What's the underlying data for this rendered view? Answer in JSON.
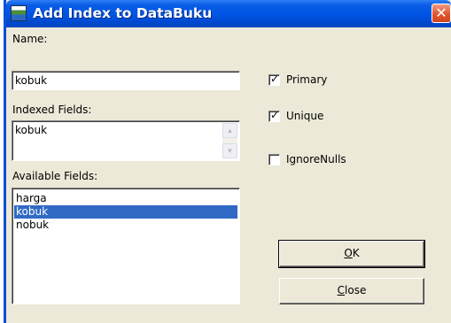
{
  "window": {
    "title": "Add Index to DataBuku",
    "close_glyph": "✕",
    "icon": "app-icon"
  },
  "form": {
    "name_label": "Name:",
    "name_value": "kobuk",
    "indexed_label": "Indexed Fields:",
    "indexed_value": "kobuk",
    "available_label": "Available Fields:",
    "available_items": [
      "harga",
      "kobuk",
      "nobuk"
    ],
    "selected_item": "kobuk"
  },
  "options": {
    "primary": {
      "label": "Primary",
      "checked": true
    },
    "unique": {
      "label": "Unique",
      "checked": true
    },
    "ignore_nulls": {
      "label": "IgnoreNulls",
      "checked": false
    }
  },
  "buttons": {
    "ok": {
      "mnemonic": "O",
      "rest": "K"
    },
    "close": {
      "mnemonic": "C",
      "rest": "lose"
    }
  },
  "colors": {
    "titlebar": "#0054e3",
    "selection": "#316ac5",
    "dialog": "#ece9d8",
    "close_button": "#e0552f"
  }
}
